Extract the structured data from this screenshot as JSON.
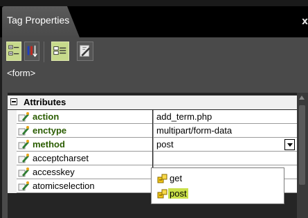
{
  "panel": {
    "title": "Tag Properties",
    "close_glyph": "x"
  },
  "toolbar": {
    "buttons": [
      {
        "name": "category-view",
        "icon": "categorized-icon",
        "active": true
      },
      {
        "name": "alphabetical-view",
        "icon": "sort-az-icon",
        "active": false
      },
      {
        "name": "attributes-view",
        "icon": "attributes-list-icon",
        "active": true
      },
      {
        "name": "behaviors-view",
        "icon": "behaviors-icon",
        "active": false
      }
    ]
  },
  "tag": "<form>",
  "attributes": {
    "section_label": "Attributes",
    "rows": [
      {
        "name": "action",
        "value": "add_term.php",
        "emphasis": true
      },
      {
        "name": "enctype",
        "value": "multipart/form-data",
        "emphasis": true
      },
      {
        "name": "method",
        "value": "post",
        "emphasis": true,
        "dropdown": true
      },
      {
        "name": "acceptcharset",
        "value": "",
        "emphasis": false
      },
      {
        "name": "accesskey",
        "value": "",
        "emphasis": false
      },
      {
        "name": "atomicselection",
        "value": "",
        "emphasis": false
      }
    ]
  },
  "dropdown": {
    "options": [
      {
        "label": "get",
        "selected": false
      },
      {
        "label": "post",
        "selected": true
      }
    ]
  },
  "colors": {
    "active_button": "#c7da8c",
    "selected_option": "#c9e04a",
    "emphasis_text": "#2a5c00"
  }
}
